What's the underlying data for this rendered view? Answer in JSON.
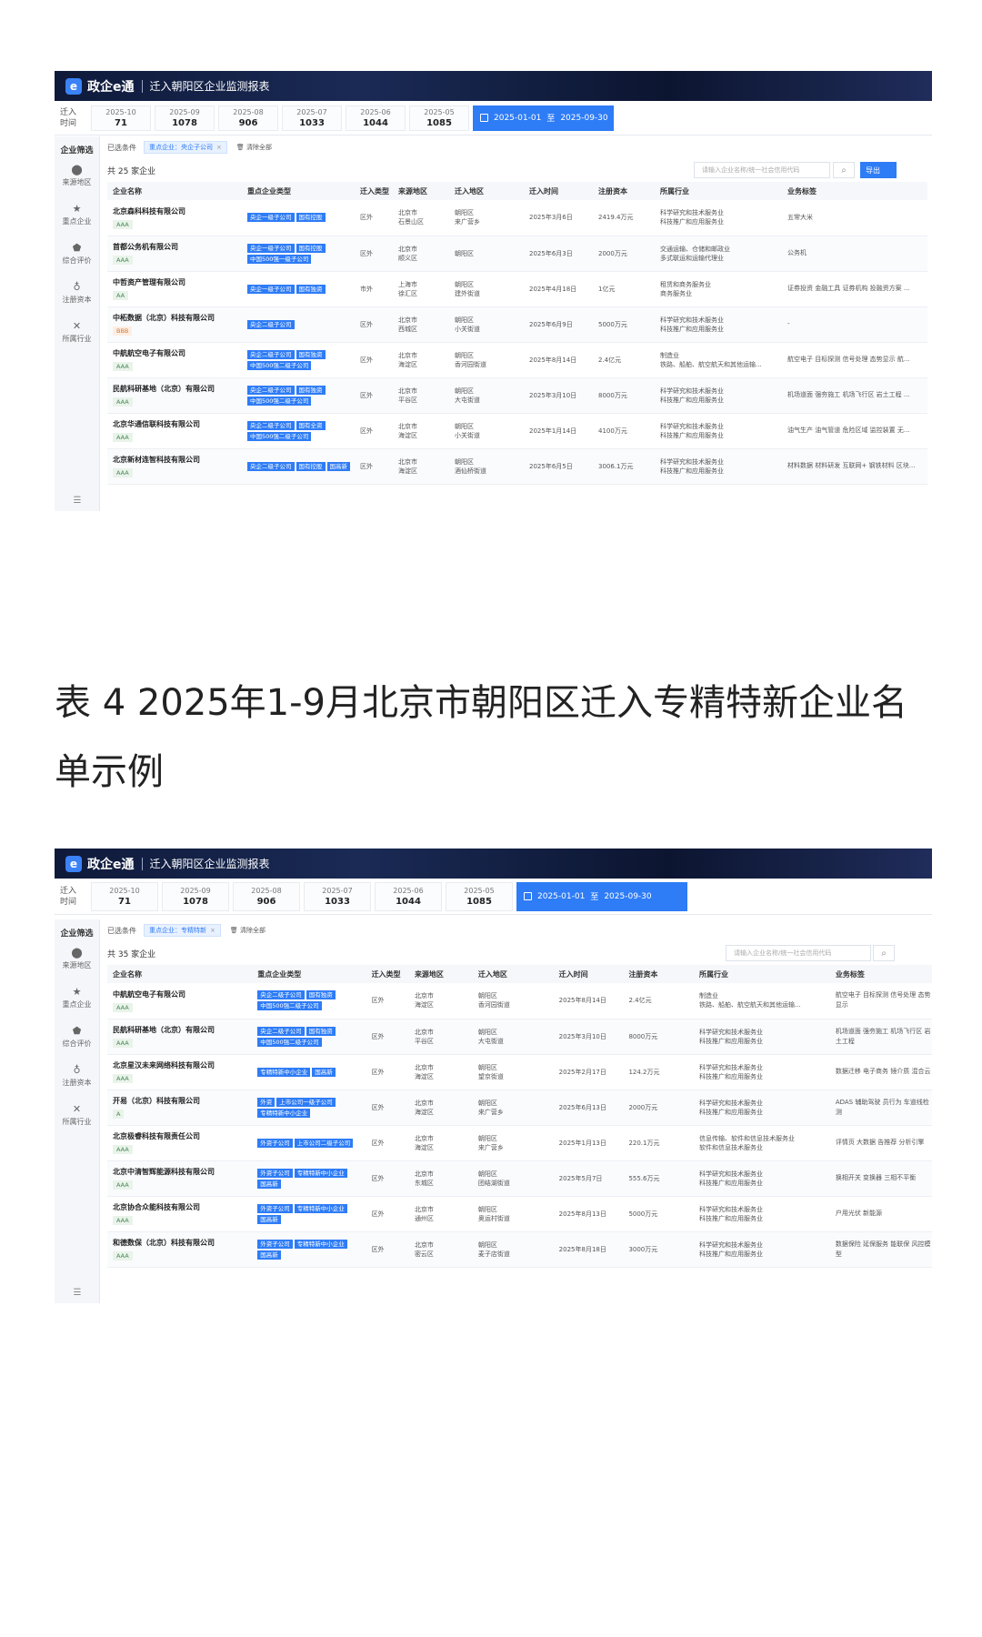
{
  "app": {
    "name": "政企e通",
    "title": "迁入朝阳区企业监测报表"
  },
  "months_label": [
    "迁入",
    "时间"
  ],
  "date_range": {
    "from": "2025-01-01",
    "to_word": "至",
    "to": "2025-09-30"
  },
  "caption": "表 4  2025年1-9月北京市朝阳区迁入专精特新企业名单示例",
  "sidebar": {
    "title": "企业筛选",
    "items": [
      {
        "icon": "location-pin-icon",
        "glyph": "⬤",
        "label": "来源地区"
      },
      {
        "icon": "star-icon",
        "glyph": "★",
        "label": "重点企业"
      },
      {
        "icon": "shield-icon",
        "glyph": "⬟",
        "label": "综合评价"
      },
      {
        "icon": "coin-icon",
        "glyph": "♁",
        "label": "注册资本"
      },
      {
        "icon": "cross-icon",
        "glyph": "✕",
        "label": "所属行业"
      }
    ],
    "bottom_icon": "☰"
  },
  "columns": [
    "企业名称",
    "重点企业类型",
    "迁入类型",
    "来源地区",
    "迁入地区",
    "迁入时间",
    "注册资本",
    "所属行业",
    "业务标签"
  ],
  "panel1": {
    "months": [
      {
        "m": "2025-10",
        "v": "71"
      },
      {
        "m": "2025-09",
        "v": "1078"
      },
      {
        "m": "2025-08",
        "v": "906"
      },
      {
        "m": "2025-07",
        "v": "1033"
      },
      {
        "m": "2025-06",
        "v": "1044"
      },
      {
        "m": "2025-05",
        "v": "1085"
      }
    ],
    "filter_label": "已选条件",
    "chip": "重点企业：央企子公司",
    "clear": "清除全部",
    "count": "共 25 家企业",
    "search_placeholder": "请输入企业名称/统一社会信用代码",
    "export": "导出",
    "rows": [
      {
        "name": "北京森科科技有限公司",
        "rating": "AAA",
        "tags": [
          "央企一级子公司",
          "国有控股"
        ],
        "type": "区外",
        "from": [
          "北京市",
          "石景山区"
        ],
        "to": [
          "朝阳区",
          "来广营乡"
        ],
        "date": "2025年3月6日",
        "capital": "2419.4万元",
        "industry": [
          "科学研究和技术服务业",
          "科技推广和应用服务业"
        ],
        "biz": "五常大米"
      },
      {
        "name": "首都公务机有限公司",
        "rating": "AAA",
        "tags": [
          "央企一级子公司",
          "国有控股",
          "中国500强一级子公司"
        ],
        "type": "区外",
        "from": [
          "北京市",
          "顺义区"
        ],
        "to": [
          "朝阳区",
          ""
        ],
        "date": "2025年6月3日",
        "capital": "2000万元",
        "industry": [
          "交通运输、仓储和邮政业",
          "多式联运和运输代理业"
        ],
        "biz": "公务机"
      },
      {
        "name": "中哲资产管理有限公司",
        "rating": "AA",
        "tags": [
          "央企一级子公司",
          "国有独资"
        ],
        "type": "市外",
        "from": [
          "上海市",
          "徐汇区"
        ],
        "to": [
          "朝阳区",
          "建外街道"
        ],
        "date": "2025年4月18日",
        "capital": "1亿元",
        "industry": [
          "租赁和商务服务业",
          "商务服务业"
        ],
        "biz": "证券投资 金融工具 证券机构 投融资方案 ..."
      },
      {
        "name": "中柘数据（北京）科技有限公司",
        "rating": "BBB",
        "tags": [
          "央企二级子公司"
        ],
        "type": "区外",
        "from": [
          "北京市",
          "西城区"
        ],
        "to": [
          "朝阳区",
          "小关街道"
        ],
        "date": "2025年6月9日",
        "capital": "5000万元",
        "industry": [
          "科学研究和技术服务业",
          "科技推广和应用服务业"
        ],
        "biz": "-"
      },
      {
        "name": "中航航空电子有限公司",
        "rating": "AAA",
        "tags": [
          "央企二级子公司",
          "国有独资",
          "中国500强二级子公司"
        ],
        "type": "区外",
        "from": [
          "北京市",
          "海淀区"
        ],
        "to": [
          "朝阳区",
          "香河园街道"
        ],
        "date": "2025年8月14日",
        "capital": "2.4亿元",
        "industry": [
          "制造业",
          "铁路、船舶、航空航天和其他运输..."
        ],
        "biz": "航空电子 目标探测 信号处理 态势显示 航..."
      },
      {
        "name": "民航科研基地（北京）有限公司",
        "rating": "AAA",
        "tags": [
          "央企二级子公司",
          "国有独资",
          "中国500强二级子公司"
        ],
        "type": "区外",
        "from": [
          "北京市",
          "平谷区"
        ],
        "to": [
          "朝阳区",
          "大屯街道"
        ],
        "date": "2025年3月10日",
        "capital": "8000万元",
        "industry": [
          "科学研究和技术服务业",
          "科技推广和应用服务业"
        ],
        "biz": "机场道面 强夯施工 机场飞行区 岩土工程 ..."
      },
      {
        "name": "北京华通信联科技有限公司",
        "rating": "AAA",
        "tags": [
          "央企二级子公司",
          "国有全资",
          "中国500强二级子公司"
        ],
        "type": "区外",
        "from": [
          "北京市",
          "海淀区"
        ],
        "to": [
          "朝阳区",
          "小关街道"
        ],
        "date": "2025年1月14日",
        "capital": "4100万元",
        "industry": [
          "科学研究和技术服务业",
          "科技推广和应用服务业"
        ],
        "biz": "油气生产 油气管道 危险区域 监控装置 无..."
      },
      {
        "name": "北京新材连智科技有限公司",
        "rating": "AAA",
        "tags": [
          "央企二级子公司",
          "国有控股",
          "国高新"
        ],
        "type": "区外",
        "from": [
          "北京市",
          "海淀区"
        ],
        "to": [
          "朝阳区",
          "酒仙桥街道"
        ],
        "date": "2025年6月5日",
        "capital": "3006.1万元",
        "industry": [
          "科学研究和技术服务业",
          "科技推广和应用服务业"
        ],
        "biz": "材料数据 材料研发 互联网+ 钢铁材料 区块..."
      }
    ]
  },
  "panel2": {
    "months": [
      {
        "m": "2025-10",
        "v": "71"
      },
      {
        "m": "2025-09",
        "v": "1078"
      },
      {
        "m": "2025-08",
        "v": "906"
      },
      {
        "m": "2025-07",
        "v": "1033"
      },
      {
        "m": "2025-06",
        "v": "1044"
      },
      {
        "m": "2025-05",
        "v": "1085"
      }
    ],
    "filter_label": "已选条件",
    "chip": "重点企业：专精特新",
    "clear": "清除全部",
    "count": "共 35 家企业",
    "search_placeholder": "请输入企业名称/统一社会信用代码",
    "rows": [
      {
        "name": "中航航空电子有限公司",
        "rating": "AAA",
        "tags": [
          "央企二级子公司",
          "国有独资",
          "中国500强二级子公司"
        ],
        "type": "区外",
        "from": [
          "北京市",
          "海淀区"
        ],
        "to": [
          "朝阳区",
          "香河园街道"
        ],
        "date": "2025年8月14日",
        "capital": "2.4亿元",
        "industry": [
          "制造业",
          "铁路、船舶、航空航天和其他运输..."
        ],
        "biz": "航空电子 目标探测 信号处理 态势显示"
      },
      {
        "name": "民航科研基地（北京）有限公司",
        "rating": "AAA",
        "tags": [
          "央企二级子公司",
          "国有独资",
          "中国500强二级子公司"
        ],
        "type": "区外",
        "from": [
          "北京市",
          "平谷区"
        ],
        "to": [
          "朝阳区",
          "大屯街道"
        ],
        "date": "2025年3月10日",
        "capital": "8000万元",
        "industry": [
          "科学研究和技术服务业",
          "科技推广和应用服务业"
        ],
        "biz": "机场道面 强夯施工 机场飞行区 岩土工程"
      },
      {
        "name": "北京星汉未来网络科技有限公司",
        "rating": "AAA",
        "tags": [
          "专精特新中小企业",
          "国高新"
        ],
        "type": "区外",
        "from": [
          "北京市",
          "海淀区"
        ],
        "to": [
          "朝阳区",
          "望京街道"
        ],
        "date": "2025年2月17日",
        "capital": "124.2万元",
        "industry": [
          "科学研究和技术服务业",
          "科技推广和应用服务业"
        ],
        "biz": "数据迁移 电子商务 镜介质 混合云"
      },
      {
        "name": "开易（北京）科技有限公司",
        "rating": "A",
        "tags": [
          "外资",
          "上市公司一级子公司",
          "专精特新中小企业"
        ],
        "type": "区外",
        "from": [
          "北京市",
          "海淀区"
        ],
        "to": [
          "朝阳区",
          "来广营乡"
        ],
        "date": "2025年6月13日",
        "capital": "2000万元",
        "industry": [
          "科学研究和技术服务业",
          "科技推广和应用服务业"
        ],
        "biz": "ADAS 辅助驾驶 员行为 车道线检测"
      },
      {
        "name": "北京极睿科技有限责任公司",
        "rating": "AAA",
        "tags": [
          "外资子公司",
          "上市公司二级子公司"
        ],
        "type": "区外",
        "from": [
          "北京市",
          "海淀区"
        ],
        "to": [
          "朝阳区",
          "来广营乡"
        ],
        "date": "2025年1月13日",
        "capital": "220.1万元",
        "industry": [
          "信息传输、软件和信息技术服务业",
          "软件和信息技术服务业"
        ],
        "biz": "评情页 大数据 告推荐 分析引擎"
      },
      {
        "name": "北京中清智辉能源科技有限公司",
        "rating": "AAA",
        "tags": [
          "外资子公司",
          "专精特新中小企业",
          "国高新"
        ],
        "type": "区外",
        "from": [
          "北京市",
          "东城区"
        ],
        "to": [
          "朝阳区",
          "团结湖街道"
        ],
        "date": "2025年5月7日",
        "capital": "555.6万元",
        "industry": [
          "科学研究和技术服务业",
          "科技推广和应用服务业"
        ],
        "biz": "换相开关 变换器 三相不平衡"
      },
      {
        "name": "北京协合众能科技有限公司",
        "rating": "AAA",
        "tags": [
          "外资子公司",
          "专精特新中小企业",
          "国高新"
        ],
        "type": "区外",
        "from": [
          "北京市",
          "通州区"
        ],
        "to": [
          "朝阳区",
          "奥运村街道"
        ],
        "date": "2025年8月13日",
        "capital": "5000万元",
        "industry": [
          "科学研究和技术服务业",
          "科技推广和应用服务业"
        ],
        "biz": "户用光伏 新能源"
      },
      {
        "name": "和德数保（北京）科技有限公司",
        "rating": "AAA",
        "tags": [
          "外资子公司",
          "专精特新中小企业",
          "国高新"
        ],
        "type": "区外",
        "from": [
          "北京市",
          "密云区"
        ],
        "to": [
          "朝阳区",
          "麦子店街道"
        ],
        "date": "2025年8月18日",
        "capital": "3000万元",
        "industry": [
          "科学研究和技术服务业",
          "科技推广和应用服务业"
        ],
        "biz": "数据保险 延保服务 能联保 风控模型"
      }
    ]
  }
}
